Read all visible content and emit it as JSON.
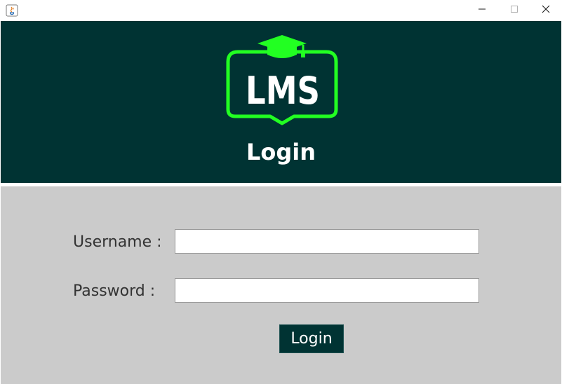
{
  "window": {
    "app_icon": "java-icon",
    "controls": {
      "minimize_icon": "minimize-icon",
      "maximize_icon": "maximize-icon",
      "close_icon": "close-icon"
    }
  },
  "header": {
    "logo_text": "LMS",
    "logo_icon": "graduation-cap-icon",
    "title": "Login"
  },
  "form": {
    "username_label": "Username :",
    "username_value": "",
    "password_label": "Password :",
    "password_value": "",
    "login_button_label": "Login"
  },
  "colors": {
    "header_bg": "#003333",
    "form_bg": "#cbcbcb",
    "logo_accent": "#22ff22",
    "button_bg": "#003333"
  }
}
